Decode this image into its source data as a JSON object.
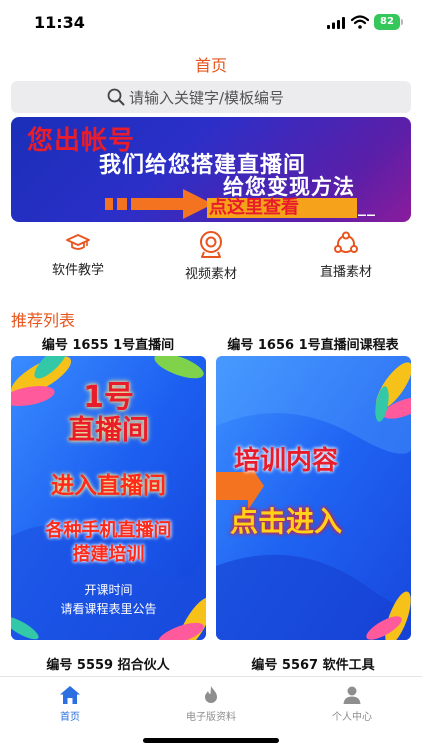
{
  "status_bar": {
    "time": "11:34",
    "battery": "82"
  },
  "nav": {
    "title": "首页"
  },
  "search": {
    "placeholder": "请输入关键字/模板编号"
  },
  "banner": {
    "line1": "您出帐号",
    "line2": "我们给您搭建直播间",
    "line3": "给您变现方法",
    "cta": "点这里查看",
    "dashes": "__"
  },
  "quick_menu": [
    {
      "label": "软件教学",
      "icon": "graduation-cap-icon"
    },
    {
      "label": "视频素材",
      "icon": "webcam-icon"
    },
    {
      "label": "直播素材",
      "icon": "network-icon"
    }
  ],
  "section": {
    "title": "推荐列表"
  },
  "cards": [
    {
      "title": "编号 1655 1号直播间",
      "image_lines": [
        "1号",
        "直播间",
        "进入直播间",
        "各种手机直播间",
        "搭建培训",
        "开课时间",
        "请看课程表里公告"
      ]
    },
    {
      "title": "编号 1656 1号直播间课程表",
      "image_lines": [
        "培训内容",
        "点击进入"
      ]
    }
  ],
  "captions": [
    "编号 5559 招合伙人",
    "编号 5567 软件工具"
  ],
  "tab_bar": [
    {
      "label": "首页",
      "icon": "home-icon",
      "active": true
    },
    {
      "label": "电子版资料",
      "icon": "flame-icon",
      "active": false
    },
    {
      "label": "个人中心",
      "icon": "user-icon",
      "active": false
    }
  ],
  "colors": {
    "accent": "#e8551f",
    "active_tab": "#2b6fe0",
    "banner_red": "#e81c2a",
    "battery_green": "#35c759"
  }
}
